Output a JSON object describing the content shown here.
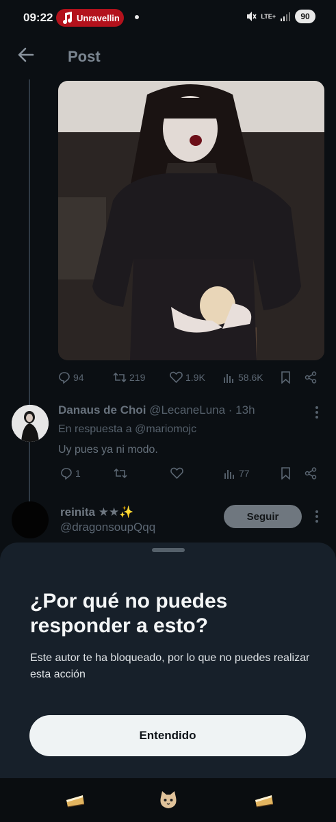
{
  "status_bar": {
    "time": "09:22",
    "music_label": "Unravellin",
    "network": "LTE+",
    "battery": "90"
  },
  "header": {
    "title": "Post"
  },
  "post_stats": {
    "replies": "94",
    "reposts": "219",
    "likes": "1.9K",
    "views": "58.6K"
  },
  "reply": {
    "name": "Danaus de Choi",
    "handle_time": "@LecaneLuna · 13h",
    "replying_to": "En respuesta a @mariomojc",
    "text": "Uy pues ya ni modo.",
    "replies": "1",
    "views": "77"
  },
  "suggested": {
    "name": "reinita ★★✨",
    "handle": "@dragonsoupQqq",
    "follow_label": "Seguir"
  },
  "sheet": {
    "title": "¿Por qué no puedes responder a esto?",
    "body": "Este autor te ha bloqueado, por lo que no puedes realizar esta acción",
    "button_label": "Entendido"
  },
  "colors": {
    "accent_red": "#b3121c",
    "sheet_bg": "#17202a",
    "button_bg": "#eff3f4"
  }
}
